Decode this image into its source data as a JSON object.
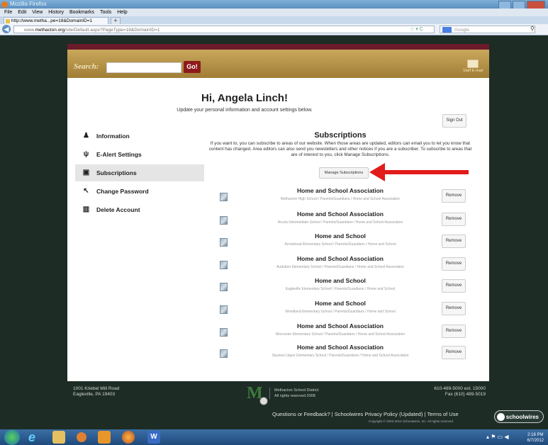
{
  "browser": {
    "window_title": "Mozilla Firefox",
    "menu": [
      "File",
      "Edit",
      "View",
      "History",
      "Bookmarks",
      "Tools",
      "Help"
    ],
    "tab_label": "http://www.metha...pe=18&DomainID=1",
    "new_tab": "+",
    "url_domain": "methacton.org",
    "url_prefix": "www.",
    "url_path": "/site/Default.aspx?PageType=18&DomainID=1",
    "search_placeholder": "Google",
    "back_icon": "back-arrow-icon"
  },
  "header": {
    "search_label": "Search:",
    "go_label": "Go!",
    "staff_email_label": "Staff E-mail"
  },
  "greeting": {
    "title": "Hi, Angela Linch!",
    "subtitle": "Update your personal information and account settings below.",
    "sign_out": "Sign Out"
  },
  "sidebar": {
    "items": [
      {
        "label": "Information",
        "icon": "person-icon",
        "glyph": "♟",
        "active": false
      },
      {
        "label": "E-Alert Settings",
        "icon": "antenna-icon",
        "glyph": "ψ",
        "active": false
      },
      {
        "label": "Subscriptions",
        "icon": "subscription-icon",
        "glyph": "▣",
        "active": true
      },
      {
        "label": "Change Password",
        "icon": "key-icon",
        "glyph": "↖",
        "active": false
      },
      {
        "label": "Delete Account",
        "icon": "trash-icon",
        "glyph": "▥",
        "active": false
      }
    ]
  },
  "subscriptions": {
    "heading": "Subscriptions",
    "description": "If you want to, you can subscribe to areas of our website. When those areas are updated, editors can email you to let you know that content has changed. Area editors can also send you newsletters and other notices if you are a subscriber. To subscribe to areas that are of interest to you, click Manage Subscriptions.",
    "manage_button": "Manage Subscriptions",
    "remove_label": "Remove",
    "items": [
      {
        "title": "Home and School Association",
        "path": "Methacton High School / Parents/Guardians / Home and School Association"
      },
      {
        "title": "Home and School Association",
        "path": "Arcola Intermediate School / Parents/Guardians / Home and School Association"
      },
      {
        "title": "Home and School",
        "path": "Arrowhead Elementary School / Parents/Guardians / Home and School"
      },
      {
        "title": "Home and School Association",
        "path": "Audubon Elementary School / Parents/Guardians / Home and School Association"
      },
      {
        "title": "Home and School",
        "path": "Eagleville Elementary School / Parents/Guardians / Home and School"
      },
      {
        "title": "Home and School",
        "path": "Woodland Elementary School / Parents/Guardians / Home and School"
      },
      {
        "title": "Home and School Association",
        "path": "Worcester Elementary School / Parents/Guardians / Home and School Association"
      },
      {
        "title": "Home and School Association",
        "path": "Skyview Upper Elementary School / Parents/Guardians / Home and School Association"
      }
    ]
  },
  "footer": {
    "address_line1": "1001 Kriebel Mill Road",
    "address_line2": "Eagleville, PA 19403",
    "district_name": "Methacton School District",
    "rights": "All rights reserved 2008",
    "phone": "610-489-5000 ext. 15000",
    "fax": "Fax (610) 489-5019",
    "links": "Questions or Feedback?  |  Schoolwires Privacy Policy (Updated)  |  Terms of Use",
    "copyright": "Copyright © 2002-2012 Schoolwires, Inc. All rights reserved.",
    "schoolwires": "schoolwires"
  },
  "taskbar": {
    "time": "2:18 PM",
    "date": "6/7/2012",
    "apps": [
      "ie-icon",
      "folder-icon",
      "media-icon",
      "outlook-icon",
      "firefox-icon",
      "word-icon"
    ]
  },
  "colors": {
    "maroon": "#6b1a2a",
    "gold": "#b8964a",
    "go_red": "#8d1b1b",
    "arrow_red": "#e21b1b",
    "page_bg": "#1d2c25"
  }
}
